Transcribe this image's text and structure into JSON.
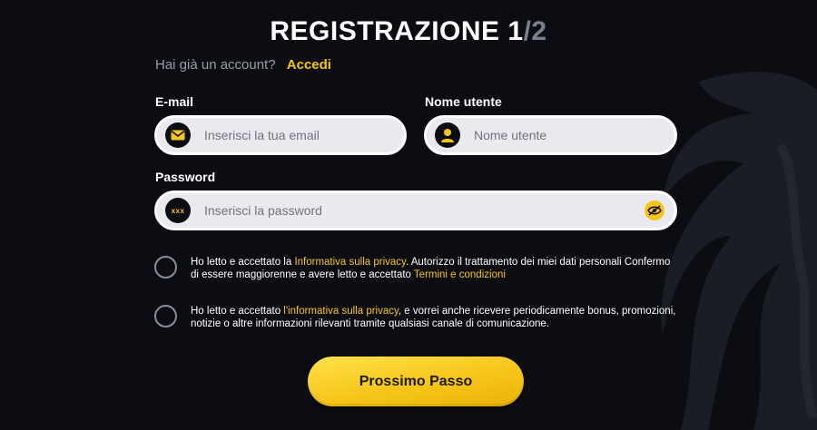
{
  "title": {
    "main": "REGISTRAZIONE 1",
    "slash_total": "/2"
  },
  "login_prompt": {
    "question": "Hai già un account?",
    "link": "Accedi"
  },
  "email": {
    "label": "E-mail",
    "placeholder": "Inserisci la tua email",
    "icon": "envelope-icon"
  },
  "username": {
    "label": "Nome utente",
    "placeholder": "Nome utente",
    "icon": "user-icon"
  },
  "password": {
    "label": "Password",
    "placeholder": "Inserisci la password",
    "icon_text": "xxx",
    "toggle_icon": "eye-off-icon"
  },
  "consent_privacy": {
    "before": "Ho letto e accettato la ",
    "link1": "Informativa sulla privacy",
    "middle": ". Autorizzo il trattamento dei miei dati personali Confermo di essere maggiorenne e avere letto e accettato ",
    "link2": "Termini e condizioni",
    "checked": false
  },
  "consent_marketing": {
    "before": "Ho letto e accettato ",
    "link": "l'informativa sulla privacy",
    "after": ", e vorrei anche ricevere periodicamente bonus, promozioni, notizie o altre informazioni rilevanti tramite qualsiasi canale di comunicazione.",
    "checked": false
  },
  "next_button": {
    "label": "Prossimo Passo"
  },
  "colors": {
    "accent": "#f5c518",
    "background": "#0b0d12",
    "field_bg": "#e9e9ee"
  }
}
